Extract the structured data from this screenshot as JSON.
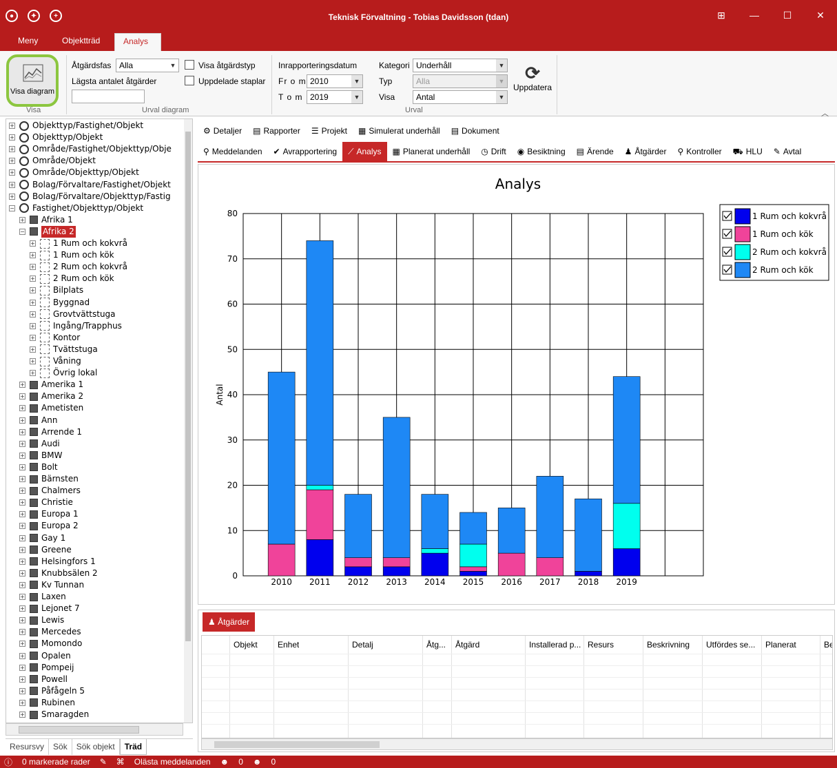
{
  "window": {
    "title": "Teknisk Förvaltning - Tobias Davidsson (tdan)",
    "controls": [
      "minimize",
      "maximize",
      "close"
    ]
  },
  "menu_tabs": [
    "Meny",
    "Objektträd",
    "Analys"
  ],
  "ribbon": {
    "visa_diagram": "Visa diagram",
    "visa_group": "Visa",
    "atgardsfas_label": "Åtgärdsfas",
    "atgardsfas_value": "Alla",
    "lagsta_label": "Lägsta antalet åtgärder",
    "lagsta_value": "",
    "visa_atgardstyp": "Visa åtgärdstyp",
    "uppdelade_staplar": "Uppdelade staplar",
    "urval_diagram_group": "Urval diagram",
    "inrapp_label": "Inrapporteringsdatum",
    "from_label": "Fr o m",
    "from_value": "2010",
    "tom_label": "T o m",
    "tom_value": "2019",
    "kategori_label": "Kategori",
    "kategori_value": "Underhåll",
    "typ_label": "Typ",
    "typ_value": "Alla",
    "visa_label": "Visa",
    "visa_value": "Antal",
    "urval_group": "Urval",
    "uppdatera": "Uppdatera"
  },
  "tree": [
    {
      "label": "Objekttyp/Fastighet/Objekt",
      "level": 0,
      "icon": "globe-people-icon",
      "exp": "+"
    },
    {
      "label": "Objekttyp/Objekt",
      "level": 0,
      "icon": "globe-people-icon",
      "exp": "+"
    },
    {
      "label": "Område/Fastighet/Objekttyp/Obje",
      "level": 0,
      "icon": "globe-people-icon",
      "exp": "+"
    },
    {
      "label": "Område/Objekt",
      "level": 0,
      "icon": "globe-people-icon",
      "exp": "+"
    },
    {
      "label": "Område/Objekttyp/Objekt",
      "level": 0,
      "icon": "globe-people-icon",
      "exp": "+"
    },
    {
      "label": "Bolag/Förvaltare/Fastighet/Objekt",
      "level": 0,
      "icon": "globe-icon",
      "exp": "+"
    },
    {
      "label": "Bolag/Förvaltare/Objekttyp/Fastig",
      "level": 0,
      "icon": "globe-icon",
      "exp": "+"
    },
    {
      "label": "Fastighet/Objekttyp/Objekt",
      "level": 0,
      "icon": "globe-icon",
      "exp": "−"
    },
    {
      "label": "Afrika 1",
      "level": 1,
      "icon": "building-icon",
      "exp": "+"
    },
    {
      "label": "Afrika 2",
      "level": 1,
      "icon": "building-icon",
      "exp": "−",
      "selected": true
    },
    {
      "label": "1 Rum och kokvrå",
      "level": 2,
      "icon": "room-icon",
      "exp": "+"
    },
    {
      "label": "1 Rum och kök",
      "level": 2,
      "icon": "room-icon",
      "exp": "+"
    },
    {
      "label": "2 Rum och kokvrå",
      "level": 2,
      "icon": "room-icon",
      "exp": "+"
    },
    {
      "label": "2 Rum och kök",
      "level": 2,
      "icon": "room-icon",
      "exp": "+"
    },
    {
      "label": "Bilplats",
      "level": 2,
      "icon": "room-icon",
      "exp": "+"
    },
    {
      "label": "Byggnad",
      "level": 2,
      "icon": "room-icon",
      "exp": "+"
    },
    {
      "label": "Grovtvättstuga",
      "level": 2,
      "icon": "room-icon",
      "exp": "+"
    },
    {
      "label": "Ingång/Trapphus",
      "level": 2,
      "icon": "room-icon",
      "exp": "+"
    },
    {
      "label": "Kontor",
      "level": 2,
      "icon": "room-icon",
      "exp": "+"
    },
    {
      "label": "Tvättstuga",
      "level": 2,
      "icon": "room-icon",
      "exp": "+"
    },
    {
      "label": "Våning",
      "level": 2,
      "icon": "room-icon",
      "exp": "+"
    },
    {
      "label": "Övrig lokal",
      "level": 2,
      "icon": "room-icon",
      "exp": "+"
    },
    {
      "label": "Amerika 1",
      "level": 1,
      "icon": "building-icon",
      "exp": "+"
    },
    {
      "label": "Amerika 2",
      "level": 1,
      "icon": "building-icon",
      "exp": "+"
    },
    {
      "label": "Ametisten",
      "level": 1,
      "icon": "building-icon",
      "exp": "+"
    },
    {
      "label": "Ann",
      "level": 1,
      "icon": "building-icon",
      "exp": "+"
    },
    {
      "label": "Arrende 1",
      "level": 1,
      "icon": "building-icon",
      "exp": "+"
    },
    {
      "label": "Audi",
      "level": 1,
      "icon": "building-icon",
      "exp": "+"
    },
    {
      "label": "BMW",
      "level": 1,
      "icon": "building-icon",
      "exp": "+"
    },
    {
      "label": "Bolt",
      "level": 1,
      "icon": "building-icon",
      "exp": "+"
    },
    {
      "label": "Bärnsten",
      "level": 1,
      "icon": "building-icon",
      "exp": "+"
    },
    {
      "label": "Chalmers",
      "level": 1,
      "icon": "building-icon",
      "exp": "+"
    },
    {
      "label": "Christie",
      "level": 1,
      "icon": "building-icon",
      "exp": "+"
    },
    {
      "label": "Europa 1",
      "level": 1,
      "icon": "building-icon",
      "exp": "+"
    },
    {
      "label": "Europa 2",
      "level": 1,
      "icon": "building-icon",
      "exp": "+"
    },
    {
      "label": "Gay 1",
      "level": 1,
      "icon": "building-icon",
      "exp": "+"
    },
    {
      "label": "Greene",
      "level": 1,
      "icon": "building-icon",
      "exp": "+"
    },
    {
      "label": "Helsingfors 1",
      "level": 1,
      "icon": "building-icon",
      "exp": "+"
    },
    {
      "label": "Knubbsälen 2",
      "level": 1,
      "icon": "building-icon",
      "exp": "+"
    },
    {
      "label": "Kv Tunnan",
      "level": 1,
      "icon": "building-icon",
      "exp": "+"
    },
    {
      "label": "Laxen",
      "level": 1,
      "icon": "building-icon",
      "exp": "+"
    },
    {
      "label": "Lejonet 7",
      "level": 1,
      "icon": "building-icon",
      "exp": "+"
    },
    {
      "label": "Lewis",
      "level": 1,
      "icon": "building-icon",
      "exp": "+"
    },
    {
      "label": "Mercedes",
      "level": 1,
      "icon": "building-icon",
      "exp": "+"
    },
    {
      "label": "Momondo",
      "level": 1,
      "icon": "building-icon",
      "exp": "+"
    },
    {
      "label": "Opalen",
      "level": 1,
      "icon": "building-icon",
      "exp": "+"
    },
    {
      "label": "Pompeij",
      "level": 1,
      "icon": "building-icon",
      "exp": "+"
    },
    {
      "label": "Powell",
      "level": 1,
      "icon": "building-icon",
      "exp": "+"
    },
    {
      "label": "Påfågeln 5",
      "level": 1,
      "icon": "building-icon",
      "exp": "+"
    },
    {
      "label": "Rubinen",
      "level": 1,
      "icon": "building-icon",
      "exp": "+"
    },
    {
      "label": "Smaragden",
      "level": 1,
      "icon": "building-icon",
      "exp": "+"
    }
  ],
  "left_tabs": [
    "Resursvy",
    "Sök",
    "Sök objekt",
    "Träd"
  ],
  "detail_tabs_row1": [
    {
      "label": "Detaljer",
      "icon": "gears-icon"
    },
    {
      "label": "Rapporter",
      "icon": "printer-icon"
    },
    {
      "label": "Projekt",
      "icon": "project-icon"
    },
    {
      "label": "Simulerat underhåll",
      "icon": "calendar-icon"
    },
    {
      "label": "Dokument",
      "icon": "document-icon"
    }
  ],
  "detail_tabs_row2": [
    {
      "label": "Meddelanden",
      "icon": "message-icon"
    },
    {
      "label": "Avrapportering",
      "icon": "check-icon"
    },
    {
      "label": "Analys",
      "icon": "chart-icon",
      "active": true
    },
    {
      "label": "Planerat underhåll",
      "icon": "calendar-icon"
    },
    {
      "label": "Drift",
      "icon": "clock-icon"
    },
    {
      "label": "Besiktning",
      "icon": "eye-icon"
    },
    {
      "label": "Ärende",
      "icon": "list-icon"
    },
    {
      "label": "Åtgärder",
      "icon": "worker-icon"
    },
    {
      "label": "Kontroller",
      "icon": "search-icon"
    },
    {
      "label": "HLU",
      "icon": "cart-icon"
    },
    {
      "label": "Avtal",
      "icon": "edit-icon"
    }
  ],
  "chart_data": {
    "type": "bar",
    "stacked": true,
    "title": "Analys",
    "xlabel": "",
    "ylabel": "Antal",
    "ylim": [
      0,
      80
    ],
    "yticks": [
      0,
      10,
      20,
      30,
      40,
      50,
      60,
      70,
      80
    ],
    "grid": true,
    "legend_position": "top-right",
    "categories": [
      "2010",
      "2011",
      "2012",
      "2013",
      "2014",
      "2015",
      "2016",
      "2017",
      "2018",
      "2019"
    ],
    "series": [
      {
        "name": "1 Rum och kokvrå",
        "color": "#0000ee",
        "values": [
          0,
          8,
          2,
          2,
          5,
          1,
          0,
          0,
          1,
          6
        ]
      },
      {
        "name": "1 Rum och kök",
        "color": "#f0439a",
        "values": [
          7,
          11,
          2,
          2,
          0,
          1,
          5,
          4,
          0,
          0
        ]
      },
      {
        "name": "2 Rum och kokvrå",
        "color": "#00ffee",
        "values": [
          0,
          1,
          0,
          0,
          1,
          5,
          0,
          0,
          0,
          10
        ]
      },
      {
        "name": "2 Rum och kök",
        "color": "#1e88f5",
        "values": [
          38,
          54,
          14,
          31,
          12,
          7,
          10,
          18,
          16,
          28
        ]
      }
    ]
  },
  "bottom_panel": {
    "tab": "Åtgärder",
    "columns": [
      "Objekt",
      "Enhet",
      "Detalj",
      "Åtg...",
      "Åtgärd",
      "Installerad p...",
      "Resurs",
      "Beskrivning",
      "Utfördes se...",
      "Planerat",
      "Be"
    ]
  },
  "status": {
    "markerade": "0 markerade rader",
    "olasta": "Olästa meddelanden",
    "count1": "0",
    "count2": "0"
  }
}
